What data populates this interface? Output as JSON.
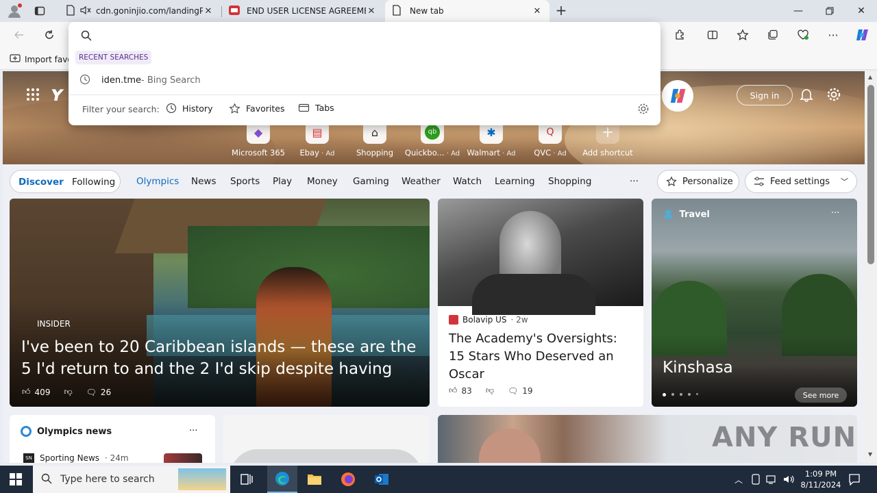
{
  "tabs": [
    {
      "title": "cdn.goninjio.com/landingP",
      "icon": "page-icon"
    },
    {
      "title": "END USER LICENSE AGREEMENT",
      "icon": "red-app-icon"
    },
    {
      "title": "New tab",
      "icon": "page-icon"
    }
  ],
  "favorites_bar": {
    "import_label": "Import favo"
  },
  "omnibox": {
    "recent_label": "RECENT SEARCHES",
    "recent_items": [
      {
        "query": "iden.tme",
        "source": " - Bing Search"
      }
    ],
    "filter_label": "Filter your search:",
    "filters": [
      "History",
      "Favorites",
      "Tabs"
    ]
  },
  "hero": {
    "sign_in": "Sign in"
  },
  "shortcuts": [
    {
      "label": "Microsoft 365",
      "ad": ""
    },
    {
      "label": "Ebay",
      "ad": " · Ad"
    },
    {
      "label": "Shopping",
      "ad": ""
    },
    {
      "label": "Quickbo...",
      "ad": " · Ad"
    },
    {
      "label": "Walmart",
      "ad": " · Ad"
    },
    {
      "label": "QVC",
      "ad": " · Ad"
    },
    {
      "label": "Add shortcut",
      "ad": ""
    }
  ],
  "nav": {
    "discover": "Discover",
    "following": "Following",
    "links": [
      "Olympics",
      "News",
      "Sports",
      "Play",
      "Money",
      "Gaming",
      "Weather",
      "Watch",
      "Learning",
      "Shopping"
    ],
    "more": "···",
    "personalize": "Personalize",
    "feed_settings": "Feed settings"
  },
  "cards": {
    "main": {
      "source": "INSIDER",
      "headline": "I've been to 20 Caribbean islands — these are the 5 I'd return to and the 2 I'd skip despite having great...",
      "likes": "409",
      "comments": "26"
    },
    "oscar": {
      "source": "Bolavip US",
      "age": "· 2w",
      "headline": "The Academy's Oversights: 15 Stars Who Deserved an Oscar",
      "likes": "83",
      "comments": "19"
    },
    "travel": {
      "category": "Travel",
      "title": "Kinshasa",
      "see_more": "See more",
      "more": "···"
    },
    "olympics": {
      "title": "Olympics news",
      "more": "···",
      "source": "Sporting News",
      "age": "· 24m"
    }
  },
  "watermark": "ANY RUN",
  "taskbar": {
    "search_placeholder": "Type here to search",
    "time": "1:09 PM",
    "date": "8/11/2024"
  },
  "colors": {
    "accent": "#0f6cbd",
    "taskbar": "#1f2a3a",
    "omnibox_label": "#5c2d91"
  }
}
